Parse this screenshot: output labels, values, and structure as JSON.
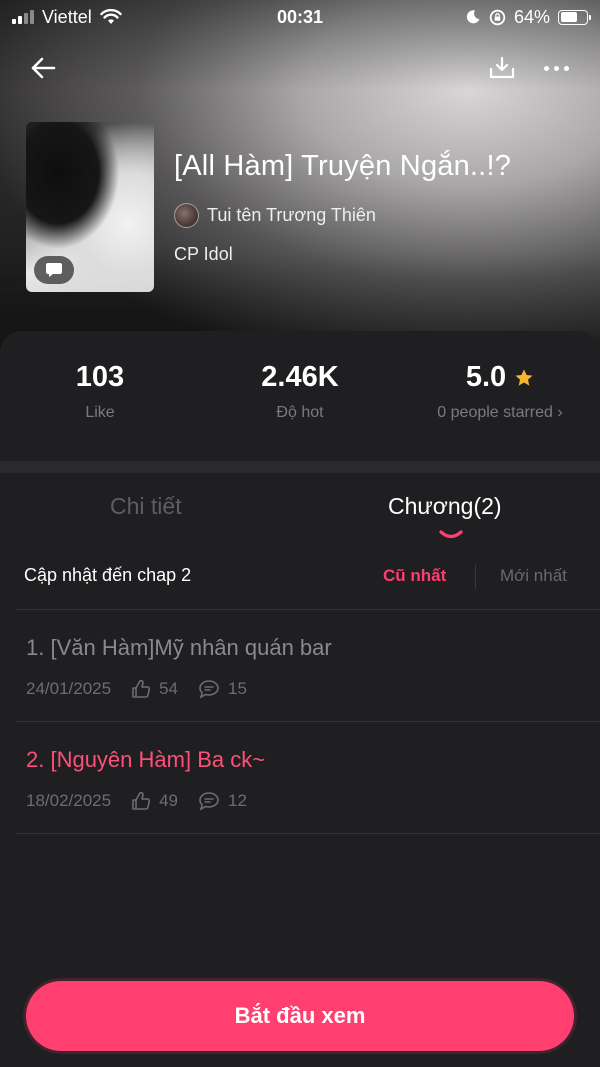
{
  "status_bar": {
    "carrier": "Viettel",
    "time": "00:31",
    "battery_text": "64%",
    "battery_level": 0.64
  },
  "book": {
    "title": "[All Hàm] Truyện Ngắn..!?",
    "author": "Tui tên Trương Thiên",
    "category": "CP Idol"
  },
  "stats": {
    "likes": "103",
    "likes_label": "Like",
    "hot": "2.46K",
    "hot_label": "Độ hot",
    "rating": "5.0",
    "rating_label": "0 people starred ›"
  },
  "tabs": {
    "detail": "Chi tiết",
    "chapters": "Chương(2)"
  },
  "chapter_list": {
    "update_label": "Cập nhật đến chap 2",
    "sort_oldest": "Cũ nhất",
    "sort_newest": "Mới nhất",
    "items": [
      {
        "title": "1. [Văn Hàm]Mỹ nhân quán bar",
        "date": "24/01/2025",
        "likes": "54",
        "comments": "15"
      },
      {
        "title": "2. [Nguyên Hàm] Ba ck~",
        "date": "18/02/2025",
        "likes": "49",
        "comments": "12"
      }
    ]
  },
  "cta_label": "Bắt đầu xem",
  "colors": {
    "accent": "#ff3f6f",
    "star": "#f5b731",
    "read_chapter": "#8a8a8d",
    "current_chapter": "#ff4f78"
  }
}
